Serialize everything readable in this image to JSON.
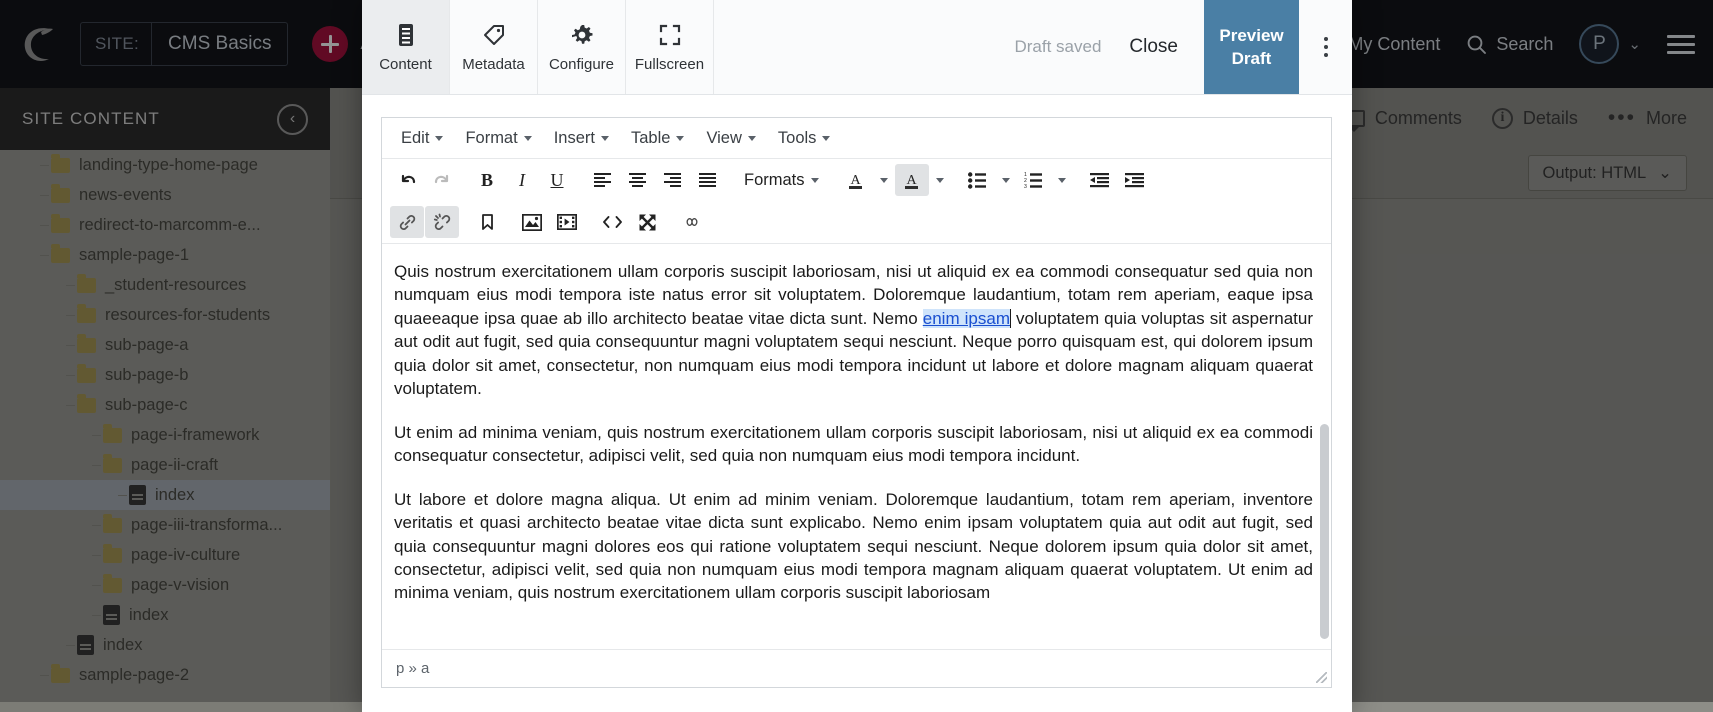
{
  "topbar": {
    "logo_icon": "crescent-logo-icon",
    "site_label": "SITE:",
    "site_value": "CMS Basics",
    "add_content_label": "Add Content",
    "my_content_label": "My Content",
    "search_label": "Search",
    "search_icon": "search-icon",
    "avatar_initial": "P",
    "chevron_icon": "chevron-down-icon",
    "menu_icon": "hamburger-menu-icon",
    "background_color": "#14161a",
    "accent_color": "#a8123e"
  },
  "sidebar": {
    "title": "SITE CONTENT",
    "collapse_icon": "chevron-left-icon",
    "tree": [
      {
        "label": "landing-type-home-page",
        "type": "folder",
        "depth": 1,
        "selected": false
      },
      {
        "label": "news-events",
        "type": "folder",
        "depth": 1,
        "selected": false
      },
      {
        "label": "redirect-to-marcomm-e...",
        "type": "folder",
        "depth": 1,
        "selected": false
      },
      {
        "label": "sample-page-1",
        "type": "folder",
        "depth": 1,
        "selected": false
      },
      {
        "label": "_student-resources",
        "type": "folder",
        "depth": 2,
        "selected": false
      },
      {
        "label": "resources-for-students",
        "type": "folder",
        "depth": 2,
        "selected": false
      },
      {
        "label": "sub-page-a",
        "type": "folder",
        "depth": 2,
        "selected": false
      },
      {
        "label": "sub-page-b",
        "type": "folder",
        "depth": 2,
        "selected": false
      },
      {
        "label": "sub-page-c",
        "type": "folder",
        "depth": 2,
        "selected": false
      },
      {
        "label": "page-i-framework",
        "type": "folder",
        "depth": 3,
        "selected": false
      },
      {
        "label": "page-ii-craft",
        "type": "folder",
        "depth": 3,
        "selected": false
      },
      {
        "label": "index",
        "type": "file",
        "depth": 4,
        "selected": true
      },
      {
        "label": "page-iii-transforma...",
        "type": "folder",
        "depth": 3,
        "selected": false
      },
      {
        "label": "page-iv-culture",
        "type": "folder",
        "depth": 3,
        "selected": false
      },
      {
        "label": "page-v-vision",
        "type": "folder",
        "depth": 3,
        "selected": false
      },
      {
        "label": "index",
        "type": "file",
        "depth": 3,
        "selected": false
      },
      {
        "label": "index",
        "type": "file",
        "depth": 2,
        "selected": false
      },
      {
        "label": "sample-page-2",
        "type": "folder",
        "depth": 1,
        "selected": false
      }
    ]
  },
  "main_toolbar": {
    "comments_label": "Comments",
    "comments_icon": "comment-bubble-icon",
    "details_label": "Details",
    "details_icon": "info-circle-icon",
    "more_label": "More",
    "more_icon": "ellipsis-icon",
    "output_label": "Output: HTML",
    "output_chevron_icon": "chevron-down-icon"
  },
  "modal": {
    "tabs": [
      {
        "label": "Content",
        "icon": "document-lines-icon",
        "active": true
      },
      {
        "label": "Metadata",
        "icon": "tag-icon",
        "active": false
      },
      {
        "label": "Configure",
        "icon": "gear-icon",
        "active": false
      },
      {
        "label": "Fullscreen",
        "icon": "expand-corners-icon",
        "active": false
      }
    ],
    "draft_status": "Draft saved",
    "close_label": "Close",
    "preview_draft_line1": "Preview",
    "preview_draft_line2": "Draft",
    "preview_draft_color": "#4a7fa5",
    "kebab_icon": "vertical-ellipsis-icon"
  },
  "editor": {
    "menus": [
      "Edit",
      "Format",
      "Insert",
      "Table",
      "View",
      "Tools"
    ],
    "toolbar_row1": [
      {
        "name": "undo-button",
        "glyph": "undo",
        "state": "enabled"
      },
      {
        "name": "redo-button",
        "glyph": "redo",
        "state": "disabled"
      },
      {
        "name": "bold-button",
        "glyph": "B",
        "state": "enabled"
      },
      {
        "name": "italic-button",
        "glyph": "I",
        "state": "enabled"
      },
      {
        "name": "underline-button",
        "glyph": "U",
        "state": "enabled"
      },
      {
        "name": "align-left-button",
        "glyph": "align-left",
        "state": "enabled"
      },
      {
        "name": "align-center-button",
        "glyph": "align-center",
        "state": "enabled"
      },
      {
        "name": "align-right-button",
        "glyph": "align-right",
        "state": "enabled"
      },
      {
        "name": "align-justify-button",
        "glyph": "align-justify",
        "state": "enabled"
      },
      {
        "name": "formats-dropdown",
        "glyph": "Formats",
        "state": "enabled"
      },
      {
        "name": "text-color-button",
        "glyph": "A",
        "state": "enabled"
      },
      {
        "name": "background-color-button",
        "glyph": "A",
        "state": "active"
      },
      {
        "name": "bullet-list-button",
        "glyph": "bullet-list",
        "state": "enabled"
      },
      {
        "name": "numbered-list-button",
        "glyph": "numbered-list",
        "state": "enabled"
      },
      {
        "name": "outdent-button",
        "glyph": "outdent",
        "state": "enabled"
      },
      {
        "name": "indent-button",
        "glyph": "indent",
        "state": "enabled"
      }
    ],
    "toolbar_row2": [
      {
        "name": "insert-link-button",
        "glyph": "link",
        "state": "active"
      },
      {
        "name": "remove-link-button",
        "glyph": "unlink",
        "state": "active"
      },
      {
        "name": "anchor-button",
        "glyph": "anchor",
        "state": "enabled"
      },
      {
        "name": "insert-image-button",
        "glyph": "image",
        "state": "enabled"
      },
      {
        "name": "insert-media-button",
        "glyph": "media",
        "state": "enabled"
      },
      {
        "name": "source-code-button",
        "glyph": "code",
        "state": "enabled"
      },
      {
        "name": "fullscreen-button",
        "glyph": "expand",
        "state": "enabled"
      },
      {
        "name": "special-character-button",
        "glyph": "infinity",
        "state": "enabled"
      }
    ],
    "formats_label": "Formats",
    "paragraphs": [
      {
        "pre": "Quis nostrum exercitationem ullam corporis suscipit laboriosam, nisi ut aliquid ex ea commodi consequatur sed quia non numquam eius modi tempora iste natus error sit voluptatem. Doloremque laudantium, totam rem aperiam, eaque ipsa quaeeaque ipsa quae ab illo  architecto beatae vitae dicta sunt. Nemo ",
        "link": "enim ipsam",
        "post": " voluptatem quia voluptas sit aspernatur aut odit aut fugit, sed quia consequuntur magni voluptatem sequi nesciunt. Neque porro quisquam est, qui dolorem ipsum quia dolor sit amet, consectetur, non numquam eius modi tempora incidunt ut labore et dolore magnam aliquam quaerat voluptatem."
      },
      {
        "pre": "Ut enim ad minima veniam, quis nostrum exercitationem ullam corporis suscipit laboriosam, nisi ut aliquid ex ea commodi consequatur consectetur, adipisci velit, sed quia non numquam eius modi tempora incidunt.",
        "link": "",
        "post": ""
      },
      {
        "pre": "Ut labore et dolore magna aliqua. Ut enim ad minim veniam. Doloremque laudantium, totam rem aperiam, inventore veritatis et quasi architecto beatae vitae dicta sunt explicabo. Nemo enim ipsam voluptatem quia aut odit aut fugit, sed quia consequuntur magni dolores eos qui ratione voluptatem sequi nesciunt. Neque dolorem ipsum quia dolor sit amet, consectetur, adipisci velit, sed quia non numquam eius modi tempora magnam aliquam quaerat voluptatem. Ut enim ad minima veniam, quis nostrum exercitationem ullam corporis suscipit laboriosam",
        "link": "",
        "post": ""
      }
    ],
    "statusbar_path": "p » a",
    "selection_highlight_color": "#cfe4fb",
    "link_color": "#1a4fd0"
  }
}
